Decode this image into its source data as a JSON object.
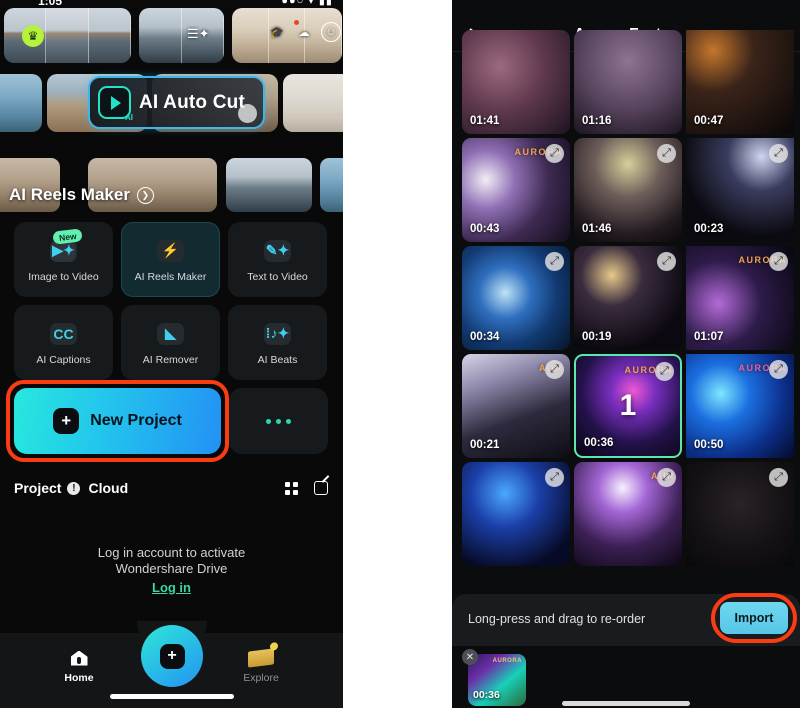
{
  "left_phone": {
    "status_bar": {
      "time": "1:05",
      "right_indicators": "●●○ ▾ ▮▮"
    },
    "top_carousel": {
      "cards": [
        {
          "name": "ferry-template",
          "badge_icon": "crown-icon"
        },
        {
          "name": "harbour-template",
          "badge_icon": "sliders-icon"
        },
        {
          "name": "cafe-template",
          "overlay_icons": [
            "graduation-cap-icon",
            "cloud-icon",
            "smiley-icon"
          ]
        }
      ]
    },
    "auto_cut_banner": {
      "label": "AI Auto Cut",
      "icon": "ai-play-icon"
    },
    "reels_banner": {
      "label": "AI Reels Maker",
      "chevron_icon": "chevron-right-circle-icon"
    },
    "features": [
      {
        "label": "Image to Video",
        "icon": "image-to-video-icon",
        "badge": "New",
        "highlight": false
      },
      {
        "label": "AI Reels Maker",
        "icon": "lightning-icon",
        "badge": "",
        "highlight": true
      },
      {
        "label": "Text  to Video",
        "icon": "pencil-icon",
        "badge": "",
        "highlight": false
      },
      {
        "label": "AI Captions",
        "icon": "cc-icon",
        "badge": "",
        "highlight": false
      },
      {
        "label": "AI Remover",
        "icon": "eraser-icon",
        "badge": "",
        "highlight": false
      },
      {
        "label": "AI Beats",
        "icon": "equalizer-note-icon",
        "badge": "",
        "highlight": false
      }
    ],
    "new_project": {
      "label": "New Project",
      "icon": "plus-square-icon",
      "highlight_color": "#f93c12"
    },
    "more_button": {
      "icon": "three-dots-icon"
    },
    "tabs": {
      "project_label": "Project",
      "info_icon": "info-icon",
      "cloud_label": "Cloud",
      "grid_icon": "grid-view-icon",
      "edit_icon": "edit-square-icon"
    },
    "empty_state": {
      "line1": "Log in account to activate",
      "line2": "Wondershare Drive",
      "login_label": "Log in",
      "login_color": "#3ad6a0"
    },
    "bottom_nav": {
      "home_label": "Home",
      "home_icon": "home-icon",
      "create_icon": "plus-fab-icon",
      "explore_label": "Explore",
      "explore_icon": "explore-banner-icon"
    }
  },
  "arrow": {
    "name": "flow-arrow",
    "color": "#b3243c",
    "direction": "right"
  },
  "right_phone": {
    "header": {
      "back_icon": "back-arrow-icon",
      "title": "Aurora Fest",
      "caret_icon": "chevron-down-icon"
    },
    "grid": {
      "rows": [
        [
          {
            "duration": "01:41",
            "art": "a1",
            "partial": true,
            "selected": false,
            "expand": false
          },
          {
            "duration": "01:16",
            "art": "a2",
            "partial": true,
            "selected": false,
            "expand": false
          },
          {
            "duration": "00:47",
            "art": "a3",
            "partial": true,
            "selected": false,
            "expand": false
          }
        ],
        [
          {
            "duration": "00:43",
            "art": "a4",
            "watermark": "AURORA",
            "wm_class": "",
            "selected": false,
            "expand": true
          },
          {
            "duration": "01:46",
            "art": "a5",
            "watermark": "",
            "wm_class": "",
            "selected": false,
            "expand": true
          },
          {
            "duration": "00:23",
            "art": "a6",
            "watermark": "",
            "wm_class": "",
            "selected": false,
            "expand": true
          }
        ],
        [
          {
            "duration": "00:34",
            "art": "a7",
            "watermark": "",
            "wm_class": "",
            "selected": false,
            "expand": true
          },
          {
            "duration": "00:19",
            "art": "a8",
            "watermark": "",
            "wm_class": "",
            "selected": false,
            "expand": true
          },
          {
            "duration": "01:07",
            "art": "a9",
            "watermark": "AURORA",
            "wm_class": "",
            "selected": false,
            "expand": true
          }
        ],
        [
          {
            "duration": "00:21",
            "art": "a10",
            "watermark": "AUR",
            "wm_class": "",
            "selected": false,
            "expand": true
          },
          {
            "duration": "00:36",
            "art": "a11",
            "watermark": "AURORA",
            "wm_class": "",
            "selected": true,
            "badge_number": "1",
            "expand": true
          },
          {
            "duration": "00:50",
            "art": "a12",
            "watermark": "AURORA",
            "wm_class": "pink",
            "selected": false,
            "expand": true
          }
        ],
        [
          {
            "duration": "",
            "art": "a13",
            "watermark": "",
            "wm_class": "",
            "selected": false,
            "expand": true
          },
          {
            "duration": "",
            "art": "a14",
            "watermark": "AUR",
            "wm_class": "",
            "selected": false,
            "expand": true
          },
          {
            "duration": "",
            "art": "a15",
            "watermark": "",
            "wm_class": "",
            "selected": false,
            "expand": true
          }
        ]
      ]
    },
    "hint_bar": {
      "text": "Long-press and drag to re-order",
      "import_label": "Import",
      "highlight_color": "#f93c12"
    },
    "tray": {
      "item": {
        "duration": "00:36",
        "watermark": "AURORA",
        "remove_icon": "close-circle-icon"
      }
    }
  }
}
